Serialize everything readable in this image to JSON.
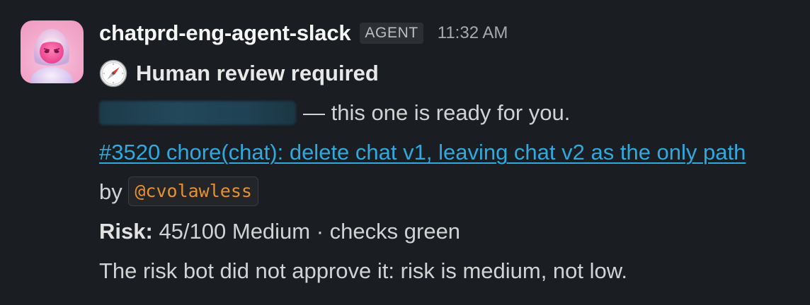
{
  "message": {
    "sender": "chatprd-eng-agent-slack",
    "badge": "AGENT",
    "timestamp": "11:32 AM",
    "title": "Human review required",
    "ready_text": "— this one is ready for you.",
    "pr_link_text": "#3520 chore(chat): delete chat v1, leaving chat v2 as the only path",
    "by_text": "by",
    "mention": "@cvolawless",
    "risk_label": "Risk:",
    "risk_value": "45/100 Medium · checks green",
    "note": "The risk bot did not approve it: risk is medium, not low."
  },
  "icons": {
    "title_icon": "compass-icon",
    "avatar": "pink-avatar"
  },
  "colors": {
    "background": "#1a1d21",
    "link": "#2fa9de",
    "mention": "#e8912d"
  }
}
